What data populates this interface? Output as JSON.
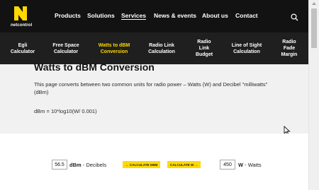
{
  "header": {
    "logo_text": "netcontrol",
    "nav": [
      {
        "label": "Products"
      },
      {
        "label": "Solutions"
      },
      {
        "label": "Services",
        "active": true
      },
      {
        "label": "News & events"
      },
      {
        "label": "About us"
      },
      {
        "label": "Contact"
      }
    ],
    "search_icon": "search-icon"
  },
  "subnav": [
    {
      "label": "Egli\nCalculator"
    },
    {
      "label": "Free Space\nCalculator"
    },
    {
      "label": "Watts to dBM\nConversion",
      "active": true
    },
    {
      "label": "Radio Link\nCalculation"
    },
    {
      "label": "Radio\nLink\nBudget"
    },
    {
      "label": "Line of Sight\nCalculation"
    },
    {
      "label": "Radio\nFade\nMargin"
    }
  ],
  "main": {
    "title": "Watts to dBM Conversion",
    "description": "This page converts between two common units for radio power – Watts (W) and Decibel \"milliwatts\" (dBm)",
    "formula": "dBm = 10*log10(W/ 0.001)"
  },
  "converter": {
    "dbm_value": "56.5",
    "dbm_unit": "dBm",
    "dbm_suffix": " - Decibels",
    "calc_dbm_label": "← CALCULATE DBM",
    "calc_w_label": "CALCULATE W →",
    "w_value": "450",
    "w_unit": "W",
    "w_suffix": " - Watts"
  },
  "colors": {
    "accent": "#ffd900",
    "header_bg": "#121212",
    "subnav_bg": "#1f1f1f",
    "page_bg": "#f1f1f1"
  }
}
